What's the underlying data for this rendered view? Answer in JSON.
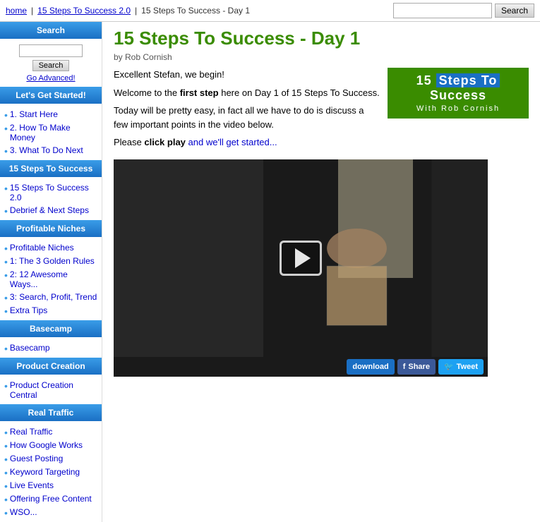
{
  "topbar": {
    "home_label": "home",
    "home_href": "#",
    "crumb1_label": "15 Steps To Success 2.0",
    "crumb1_href": "#",
    "crumb_current": "15 Steps To Success - Day 1",
    "search_placeholder": "",
    "search_btn_label": "Search"
  },
  "sidebar": {
    "search_header": "Search",
    "search_btn_label": "Search",
    "go_advanced_label": "Go Advanced!",
    "lets_get_started_header": "Let's Get Started!",
    "lets_get_started_items": [
      {
        "label": "1. Start Here"
      },
      {
        "label": "2. How To Make Money"
      },
      {
        "label": "3. What To Do Next"
      }
    ],
    "steps_header": "15 Steps To Success",
    "steps_items": [
      {
        "label": "15 Steps To Success 2.0"
      },
      {
        "label": "Debrief & Next Steps"
      }
    ],
    "profitable_header": "Profitable Niches",
    "profitable_items": [
      {
        "label": "Profitable Niches"
      },
      {
        "label": "1: The 3 Golden Rules"
      },
      {
        "label": "2: 12 Awesome Ways..."
      },
      {
        "label": "3: Search, Profit, Trend"
      },
      {
        "label": "Extra Tips"
      }
    ],
    "basecamp_header": "Basecamp",
    "basecamp_items": [
      {
        "label": "Basecamp"
      }
    ],
    "product_header": "Product Creation",
    "product_items": [
      {
        "label": "Product Creation Central"
      }
    ],
    "traffic_header": "Real Traffic",
    "traffic_items": [
      {
        "label": "Real Traffic"
      },
      {
        "label": "How Google Works"
      },
      {
        "label": "Guest Posting"
      },
      {
        "label": "Keyword Targeting"
      },
      {
        "label": "Live Events"
      },
      {
        "label": "Offering Free Content"
      },
      {
        "label": "WSO..."
      }
    ]
  },
  "main": {
    "page_title": "15 Steps To Success - Day 1",
    "author": "by Rob Cornish",
    "greeting": "Excellent Stefan, we begin!",
    "intro_p1_before": "Welcome to the ",
    "intro_p1_bold": "first step",
    "intro_p1_after": " here on Day 1 of 15 Steps To Success.",
    "intro_p2": "Today will be pretty easy, in fact all we have to do is discuss a few important points in the video below.",
    "intro_p3_before": "Please ",
    "intro_p3_bold": "click play",
    "intro_p3_after": " and we'll get started...",
    "logo_line1_pre": "15 Steps",
    "logo_line1_mid": "To",
    "logo_line1_post": "Success",
    "logo_line2": "With Rob Cornish",
    "video_btn_download": "download",
    "video_btn_share": "f  Share",
    "video_btn_tweet": "Tweet"
  }
}
